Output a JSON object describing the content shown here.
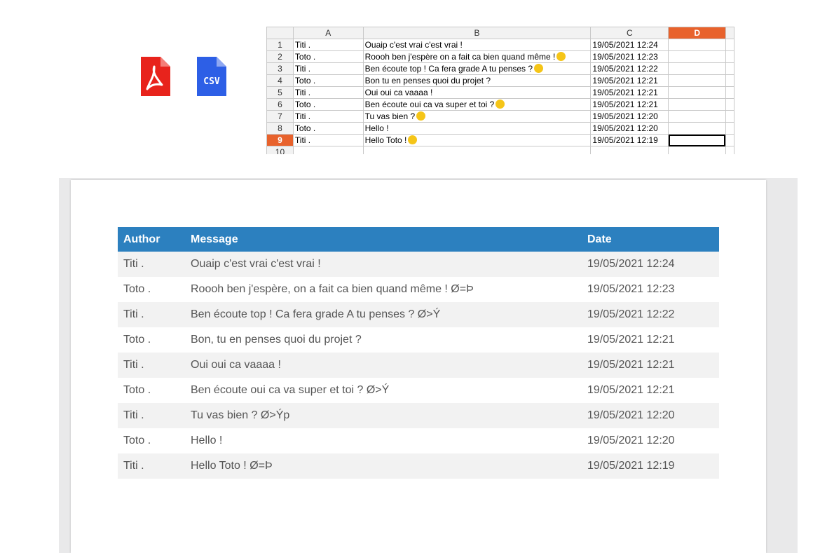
{
  "icons": {
    "pdf": "pdf-file-icon",
    "csv": "csv-file-icon",
    "csv_text": "CSV"
  },
  "colors": {
    "header_blue": "#2c80bf",
    "active_orange": "#e8622c",
    "pdf_red": "#e8231c",
    "csv_blue": "#2d5fe6"
  },
  "spreadsheet": {
    "columns": [
      "A",
      "B",
      "C",
      "D"
    ],
    "rows": [
      {
        "num": "1",
        "a": "Titi .",
        "b": "Ouaip c'est vrai c'est vrai !",
        "emoji": false,
        "c": "19/05/2021 12:24"
      },
      {
        "num": "2",
        "a": "Toto .",
        "b": "Roooh ben j'espère on a fait ca bien quand même !",
        "emoji": true,
        "c": "19/05/2021 12:23"
      },
      {
        "num": "3",
        "a": "Titi .",
        "b": "Ben écoute top ! Ca fera grade A tu penses ?",
        "emoji": true,
        "c": "19/05/2021 12:22"
      },
      {
        "num": "4",
        "a": "Toto .",
        "b": "Bon tu en penses quoi du projet ?",
        "emoji": false,
        "c": "19/05/2021 12:21"
      },
      {
        "num": "5",
        "a": "Titi .",
        "b": "Oui oui ca vaaaa !",
        "emoji": false,
        "c": "19/05/2021 12:21"
      },
      {
        "num": "6",
        "a": "Toto .",
        "b": "Ben écoute oui ca va super et toi ?",
        "emoji": true,
        "c": "19/05/2021 12:21"
      },
      {
        "num": "7",
        "a": "Titi .",
        "b": "Tu vas bien ?",
        "emoji": true,
        "c": "19/05/2021 12:20"
      },
      {
        "num": "8",
        "a": "Toto .",
        "b": "Hello !",
        "emoji": false,
        "c": "19/05/2021 12:20"
      },
      {
        "num": "9",
        "a": "Titi .",
        "b": "Hello Toto !",
        "emoji": true,
        "c": "19/05/2021 12:19"
      },
      {
        "num": "10",
        "a": "",
        "b": "",
        "emoji": false,
        "c": ""
      }
    ]
  },
  "table": {
    "headers": {
      "author": "Author",
      "message": "Message",
      "date": "Date"
    },
    "rows": [
      {
        "author": "Titi .",
        "message": "Ouaip c'est vrai c'est vrai !",
        "date": "19/05/2021 12:24"
      },
      {
        "author": "Toto .",
        "message": "Roooh ben j'espère, on a fait ca bien quand même ! Ø=Þ",
        "date": "19/05/2021 12:23"
      },
      {
        "author": "Titi .",
        "message": "Ben écoute top ! Ca fera grade A tu penses ? Ø>Ý",
        "date": "19/05/2021 12:22"
      },
      {
        "author": "Toto .",
        "message": "Bon, tu en penses quoi du projet ?",
        "date": "19/05/2021 12:21"
      },
      {
        "author": "Titi .",
        "message": "Oui oui ca vaaaa !",
        "date": "19/05/2021 12:21"
      },
      {
        "author": "Toto .",
        "message": "Ben écoute oui ca va super et toi ? Ø>Ý",
        "date": "19/05/2021 12:21"
      },
      {
        "author": "Titi .",
        "message": "Tu vas bien ? Ø>Ýp",
        "date": "19/05/2021 12:20"
      },
      {
        "author": "Toto .",
        "message": "Hello !",
        "date": "19/05/2021 12:20"
      },
      {
        "author": "Titi .",
        "message": "Hello Toto ! Ø=Þ",
        "date": "19/05/2021 12:19"
      }
    ]
  }
}
